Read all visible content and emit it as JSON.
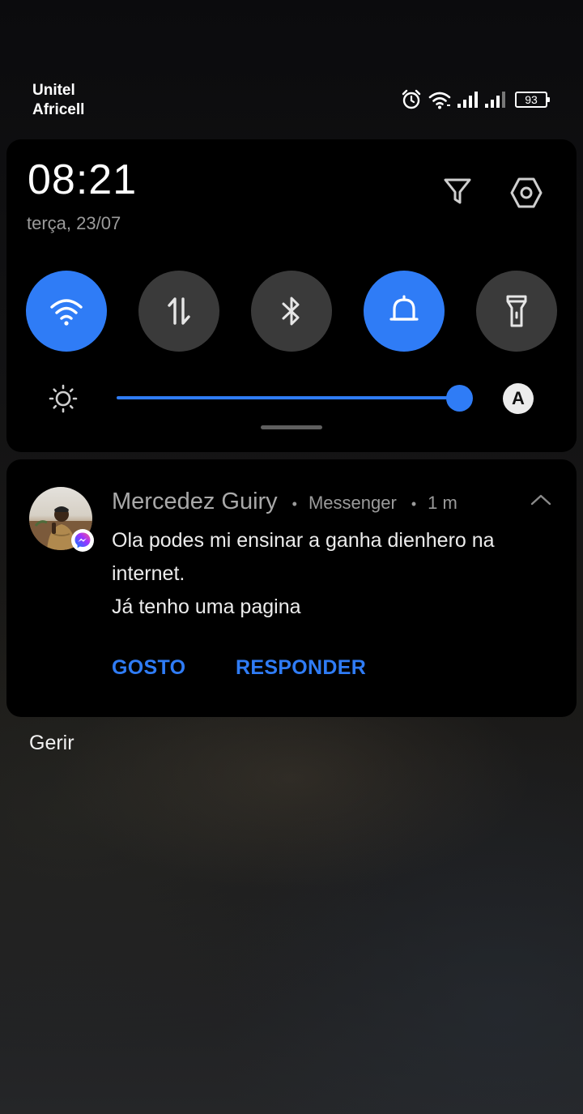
{
  "status_bar": {
    "carrier_1": "Unitel",
    "carrier_2": "Africell",
    "battery_level": "93",
    "icons": [
      "alarm-icon",
      "wifi-icon",
      "signal-icon",
      "signal-icon",
      "battery-icon"
    ]
  },
  "quick_settings": {
    "time": "08:21",
    "date": "terça, 23/07",
    "header_icons": [
      "filter-icon",
      "settings-icon"
    ],
    "tiles": [
      {
        "name": "wifi",
        "icon": "wifi-icon",
        "active": true
      },
      {
        "name": "mobile-data",
        "icon": "data-transfer-icon",
        "active": false
      },
      {
        "name": "bluetooth",
        "icon": "bluetooth-icon",
        "active": false
      },
      {
        "name": "sound",
        "icon": "bell-icon",
        "active": true
      },
      {
        "name": "flashlight",
        "icon": "flashlight-icon",
        "active": false
      }
    ],
    "brightness": {
      "level": 0.98,
      "auto_label": "A"
    },
    "colors": {
      "active": "#2f7cf6",
      "inactive": "#3a3a3a",
      "panel": "#000000"
    }
  },
  "notification": {
    "sender": "Mercedez Guiry",
    "app": "Messenger",
    "time": "1 m",
    "separator": "•",
    "message_line_1": "Ola podes mi ensinar a ganha dienhero na internet.",
    "message_line_2": "Já tenho uma pagina",
    "actions": {
      "like": "GOSTO",
      "reply": "RESPONDER"
    },
    "badge_icon": "messenger-icon"
  },
  "manage_label": "Gerir"
}
